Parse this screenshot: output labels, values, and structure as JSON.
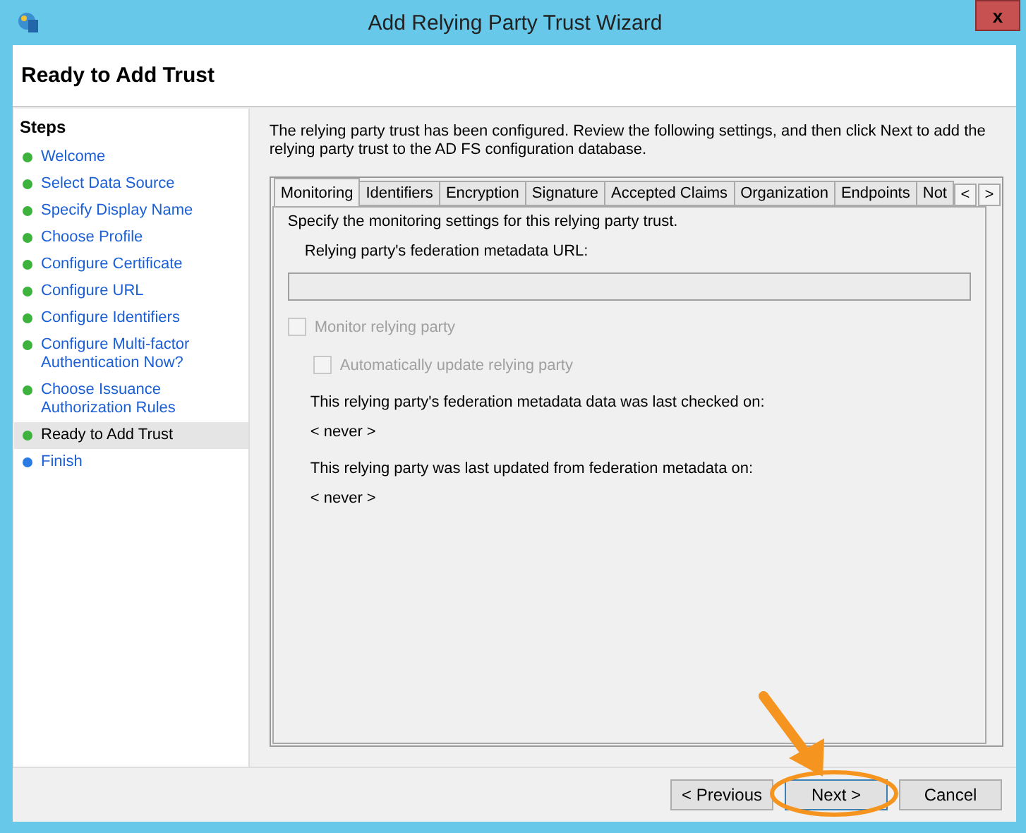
{
  "window": {
    "title": "Add Relying Party Trust Wizard",
    "close": "x"
  },
  "header": {
    "title": "Ready to Add Trust"
  },
  "steps": {
    "heading": "Steps",
    "items": [
      {
        "label": "Welcome",
        "kind": "done",
        "selected": false
      },
      {
        "label": "Select Data Source",
        "kind": "done",
        "selected": false
      },
      {
        "label": "Specify Display Name",
        "kind": "done",
        "selected": false
      },
      {
        "label": "Choose Profile",
        "kind": "done",
        "selected": false
      },
      {
        "label": "Configure Certificate",
        "kind": "done",
        "selected": false
      },
      {
        "label": "Configure URL",
        "kind": "done",
        "selected": false
      },
      {
        "label": "Configure Identifiers",
        "kind": "done",
        "selected": false
      },
      {
        "label": "Configure Multi-factor Authentication Now?",
        "kind": "done",
        "selected": false
      },
      {
        "label": "Choose Issuance Authorization Rules",
        "kind": "done",
        "selected": false
      },
      {
        "label": "Ready to Add Trust",
        "kind": "done",
        "selected": true
      },
      {
        "label": "Finish",
        "kind": "pending",
        "selected": false
      }
    ]
  },
  "intro": "The relying party trust has been configured. Review the following settings, and then click Next to add the relying party trust to the AD FS configuration database.",
  "tabs": [
    {
      "label": "Monitoring",
      "selected": true
    },
    {
      "label": "Identifiers",
      "selected": false
    },
    {
      "label": "Encryption",
      "selected": false
    },
    {
      "label": "Signature",
      "selected": false
    },
    {
      "label": "Accepted Claims",
      "selected": false
    },
    {
      "label": "Organization",
      "selected": false
    },
    {
      "label": "Endpoints",
      "selected": false
    },
    {
      "label": "Not",
      "selected": false
    }
  ],
  "tab_scroll": [
    "<",
    ">"
  ],
  "monitoring": {
    "description": "Specify the monitoring settings for this relying party trust.",
    "url_label": "Relying party's federation metadata URL:",
    "url_field": {
      "disabled": true
    },
    "checkboxes": [
      {
        "label": "Monitor relying party",
        "checked": false,
        "disabled": true
      },
      {
        "label": "Automatically update relying party",
        "checked": false,
        "disabled": true
      }
    ],
    "info": [
      {
        "label": "This relying party's federation metadata data was last checked on:",
        "value": "< never >"
      },
      {
        "label": "This relying party was last updated from federation metadata on:",
        "value": "< never >"
      }
    ]
  },
  "buttons": [
    {
      "label": "< Previous",
      "highlighted": false
    },
    {
      "label": "Next >",
      "highlighted": true
    },
    {
      "label": "Cancel",
      "highlighted": false
    }
  ]
}
